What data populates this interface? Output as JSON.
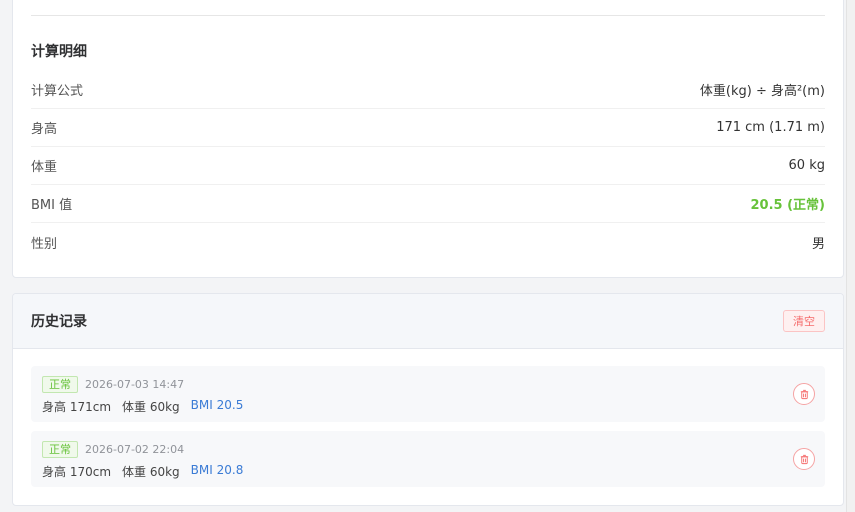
{
  "details": {
    "title": "计算明细",
    "rows": [
      {
        "label": "计算公式",
        "value": "体重(kg) ÷ 身高²(m)"
      },
      {
        "label": "身高",
        "value": "171 cm (1.71 m)"
      },
      {
        "label": "体重",
        "value": "60 kg"
      },
      {
        "label": "BMI 值",
        "value": "20.5 (正常)"
      },
      {
        "label": "性别",
        "value": "男"
      }
    ]
  },
  "history": {
    "title": "历史记录",
    "clear_label": "清空",
    "items": [
      {
        "tag": "正常",
        "time": "2026-07-03 14:47",
        "height": "身高 171cm",
        "weight": "体重 60kg",
        "bmi": "BMI 20.5"
      },
      {
        "tag": "正常",
        "time": "2026-07-02 22:04",
        "height": "身高 170cm",
        "weight": "体重 60kg",
        "bmi": "BMI 20.8"
      }
    ]
  },
  "colors": {
    "normal": "#67c23a",
    "bmi_link": "#3a7bd5",
    "danger": "#f56c6c"
  },
  "icons": {
    "delete": "trash-icon"
  }
}
